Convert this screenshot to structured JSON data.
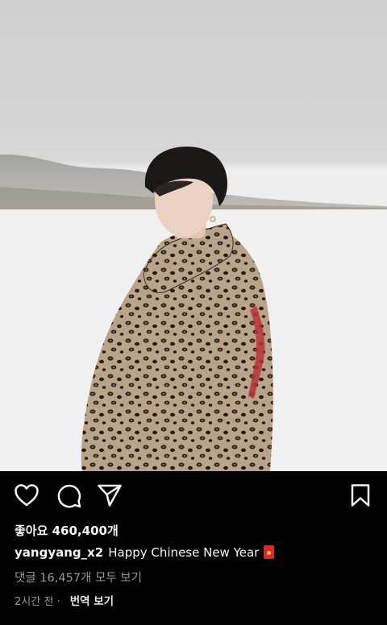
{
  "post": {
    "image_alt": "Person in leopard-print puffer jacket standing in snowy field"
  },
  "actions": {
    "like_icon": "heart-icon",
    "comment_icon": "comment-icon",
    "share_icon": "send-icon",
    "save_icon": "bookmark-icon"
  },
  "likes": {
    "text": "좋아요 460,400개"
  },
  "caption": {
    "username": "yangyang_x2",
    "text": "Happy Chinese New Year",
    "emoji_icon": "red-envelope-icon"
  },
  "comments": {
    "text": "댓글 16,457개 모두 보기"
  },
  "meta": {
    "time": "2시간 전",
    "separator": "·",
    "translate": "번역 보기"
  },
  "colors": {
    "background": "#000000",
    "secondary_text": "#9a9a9a",
    "envelope_red": "#e5252a"
  }
}
